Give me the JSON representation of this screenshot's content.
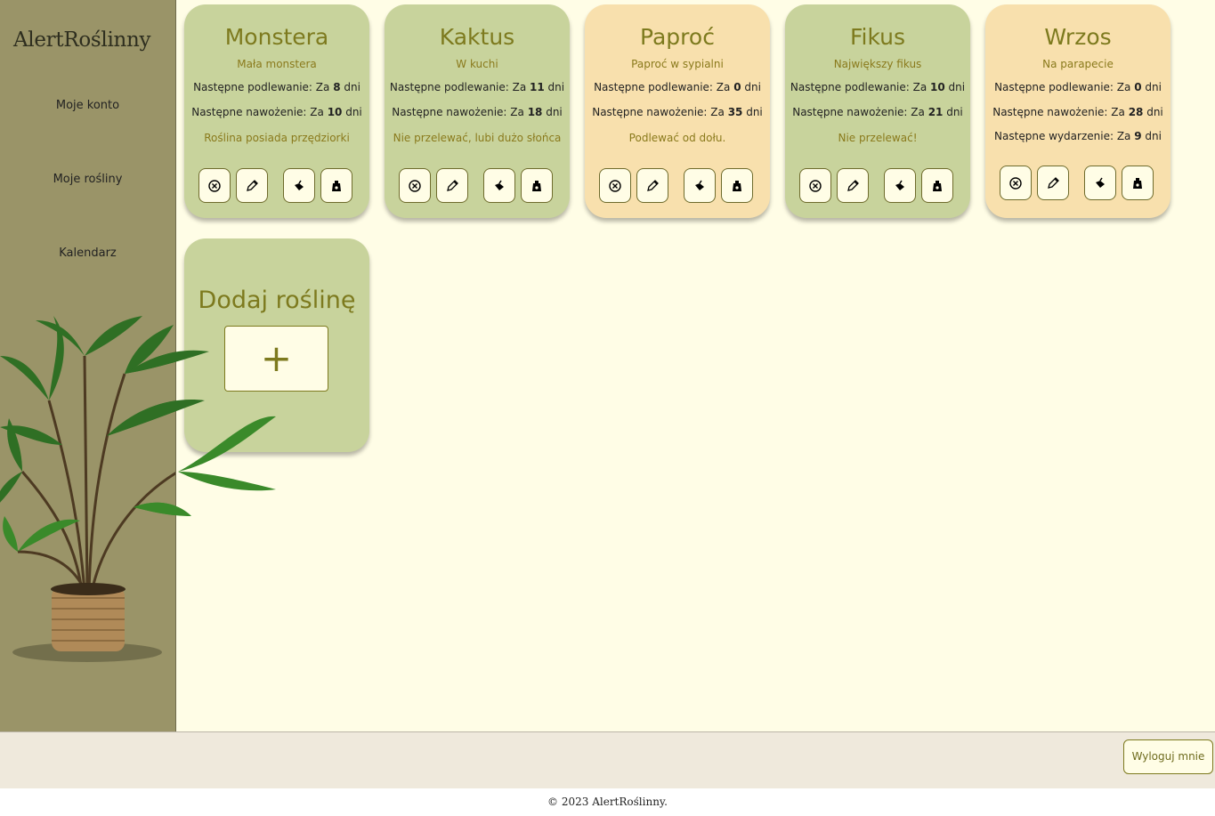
{
  "app": {
    "logo": "AlertRoślinny"
  },
  "nav": [
    "Moje konto",
    "Moje rośliny",
    "Kalendarz"
  ],
  "labels": {
    "watering": "Następne podlewanie: Za ",
    "fertilizing": "Następne nawożenie: Za ",
    "event": "Następne wydarzenie: Za ",
    "days": " dni"
  },
  "plants": [
    {
      "name": "Monstera",
      "location": "Mała monstera",
      "watering_days": "8",
      "fertilizing_days": "10",
      "note": "Roślina posiada przędziorki",
      "color": "green"
    },
    {
      "name": "Kaktus",
      "location": "W kuchi",
      "watering_days": "11",
      "fertilizing_days": "18",
      "note": "Nie przelewać, lubi dużo słońca",
      "color": "green"
    },
    {
      "name": "Paproć",
      "location": "Paproć w sypialni",
      "watering_days": "0",
      "fertilizing_days": "35",
      "note": "Podlewać od dołu.",
      "color": "orange"
    },
    {
      "name": "Fikus",
      "location": "Największy fikus",
      "watering_days": "10",
      "fertilizing_days": "21",
      "note": "Nie przelewać!",
      "color": "green"
    },
    {
      "name": "Wrzos",
      "location": "Na parapecie",
      "watering_days": "0",
      "fertilizing_days": "28",
      "event_days": "9",
      "note": "",
      "color": "orange"
    }
  ],
  "add_card": {
    "title": "Dodaj roślinę",
    "button": "+"
  },
  "logout": "Wyloguj mnie",
  "footer": "© 2023 AlertRoślinny.",
  "colors": {
    "sidebar": "#9a9468",
    "main_bg": "#fffde6",
    "card_green": "#c8d39c",
    "card_orange": "#f8e0ad",
    "accent": "#7d7a1e"
  },
  "icons": [
    "delete-icon",
    "edit-icon",
    "watering-can-icon",
    "fertilizer-bag-icon"
  ]
}
